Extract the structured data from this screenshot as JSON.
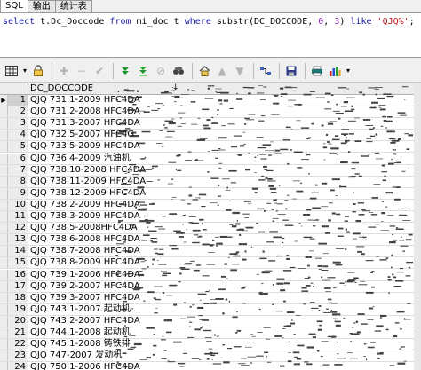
{
  "tabs": [
    {
      "label": "SQL"
    },
    {
      "label": "输出"
    },
    {
      "label": "统计表"
    }
  ],
  "editor": {
    "kw_select": "select",
    "col": " t.Dc_Doccode ",
    "kw_from": "from",
    "tbl": " mi_doc t ",
    "kw_where": "where",
    "fn": " substr(DC_DOCCODE, ",
    "n0": "0",
    "comma": ", ",
    "n3": "3",
    "close": ") ",
    "kw_like": "like",
    "space": " ",
    "lit": "'QJQ%'",
    "semi": ";"
  },
  "toolbar": {
    "icons": [
      "grid-icon",
      "lock-icon",
      "add-row-icon",
      "delete-row-icon",
      "post-icon",
      "next-record-icon",
      "last-record-icon",
      "clear-icon",
      "find-icon",
      "home-icon",
      "prev-icon",
      "next-icon",
      "query-icon",
      "save-icon",
      "print-icon",
      "chart-icon"
    ]
  },
  "grid": {
    "column_header": "DC_DOCCODE",
    "sort_indicator": "↓",
    "rows": [
      {
        "n": "1",
        "v": "QJQ 731.1-2009 HFC4DA"
      },
      {
        "n": "2",
        "v": "QJQ 731.2-2008 HFC4DA"
      },
      {
        "n": "3",
        "v": "QJQ 731.3-2007 HFC4DA"
      },
      {
        "n": "4",
        "v": "QJQ 732.5-2007 HFC4G"
      },
      {
        "n": "5",
        "v": "QJQ 733.5-2009 HFC4DA"
      },
      {
        "n": "6",
        "v": "QJQ 736.4-2009 汽油机"
      },
      {
        "n": "7",
        "v": "QJQ 738.10-2008 HFC4DA"
      },
      {
        "n": "8",
        "v": "QJQ 738.11-2009 HFC4DA"
      },
      {
        "n": "9",
        "v": "QJQ 738.12-2009 HFC4DA"
      },
      {
        "n": "10",
        "v": "QJQ 738.2-2009 HFC4DA"
      },
      {
        "n": "11",
        "v": "QJQ 738.3-2009 HFC4DA"
      },
      {
        "n": "12",
        "v": "QJQ 738.5-2008HFC4DA"
      },
      {
        "n": "13",
        "v": "QJQ 738.6-2008 HFC4DA"
      },
      {
        "n": "14",
        "v": "QJQ 738.7-2008 HFC4DA"
      },
      {
        "n": "15",
        "v": "QJQ 738.8-2009 HFC4DA"
      },
      {
        "n": "16",
        "v": "QJQ 739.1-2006 HFC4DA"
      },
      {
        "n": "17",
        "v": "QJQ 739.2-2007 HFC4DA"
      },
      {
        "n": "18",
        "v": "QJQ 739.3-2007 HFC4DA"
      },
      {
        "n": "19",
        "v": "QJQ 743.1-2007 起动机"
      },
      {
        "n": "20",
        "v": "QJQ 743.2-2007 HFC4DA"
      },
      {
        "n": "21",
        "v": "QJQ 744.1-2008 起动机"
      },
      {
        "n": "22",
        "v": "QJQ 745.1-2008 铸铁排"
      },
      {
        "n": "23",
        "v": "QJQ 747-2007 发动机"
      },
      {
        "n": "24",
        "v": "QJQ 750.1-2006 HFC4DA"
      }
    ]
  }
}
